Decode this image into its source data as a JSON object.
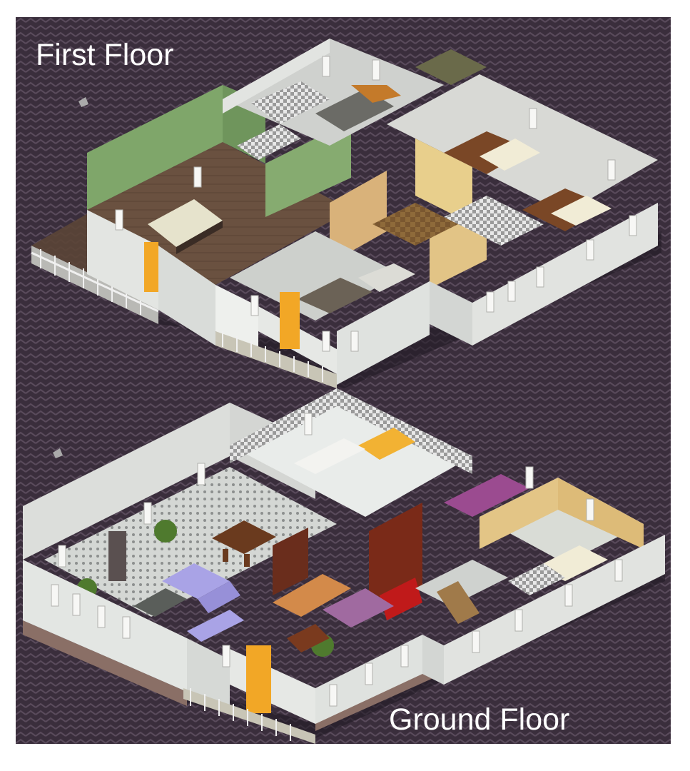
{
  "labels": {
    "first_floor": "First Floor",
    "ground_floor": "Ground Floor"
  },
  "colors": {
    "background": "#3b2f3d",
    "wall_white": "#dfe3e1",
    "wall_green": "#7fa66a",
    "wall_yellow": "#e3c586",
    "door": "#f2a726",
    "floor_brown": "#6c5442",
    "floor_tile": "#cfd2cf",
    "sofa": "#a9a3e6",
    "purple_wall": "#9b4b90",
    "dark_red": "#7a2a18"
  }
}
